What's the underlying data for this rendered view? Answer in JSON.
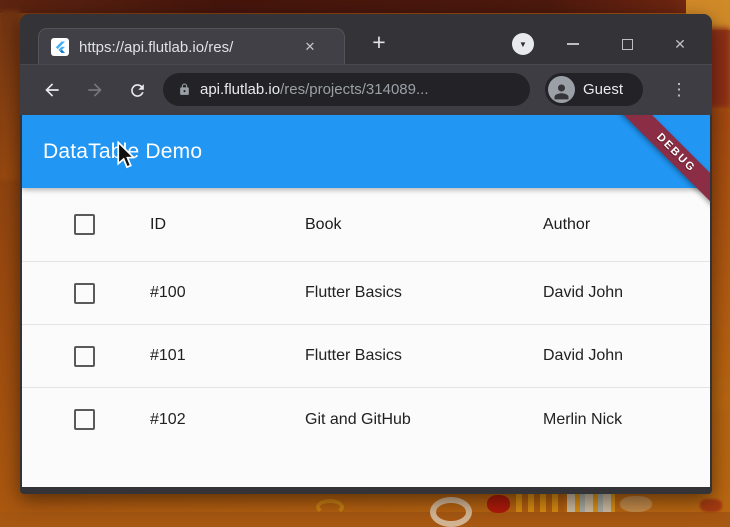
{
  "browser": {
    "tab": {
      "title": "https://api.flutlab.io/res/",
      "close_glyph": "✕"
    },
    "new_tab_glyph": "+",
    "tab_search_glyph": "▼",
    "window_controls": {
      "close_glyph": "✕"
    },
    "toolbar": {
      "url_host": "api.flutlab.io",
      "url_path": "/res/projects/314089...",
      "profile_label": "Guest",
      "menu_glyph": "⋮"
    }
  },
  "app": {
    "title": "DataTable Demo",
    "debug_banner": "DEBUG",
    "colors": {
      "appbar": "#2196f3",
      "ribbon": "#8b2d44"
    },
    "table": {
      "headers": [
        "ID",
        "Book",
        "Author"
      ],
      "rows": [
        {
          "id": "#100",
          "book": "Flutter Basics",
          "author": "David John"
        },
        {
          "id": "#101",
          "book": "Flutter Basics",
          "author": "David John"
        },
        {
          "id": "#102",
          "book": "Git and GitHub",
          "author": "Merlin Nick"
        }
      ]
    }
  }
}
